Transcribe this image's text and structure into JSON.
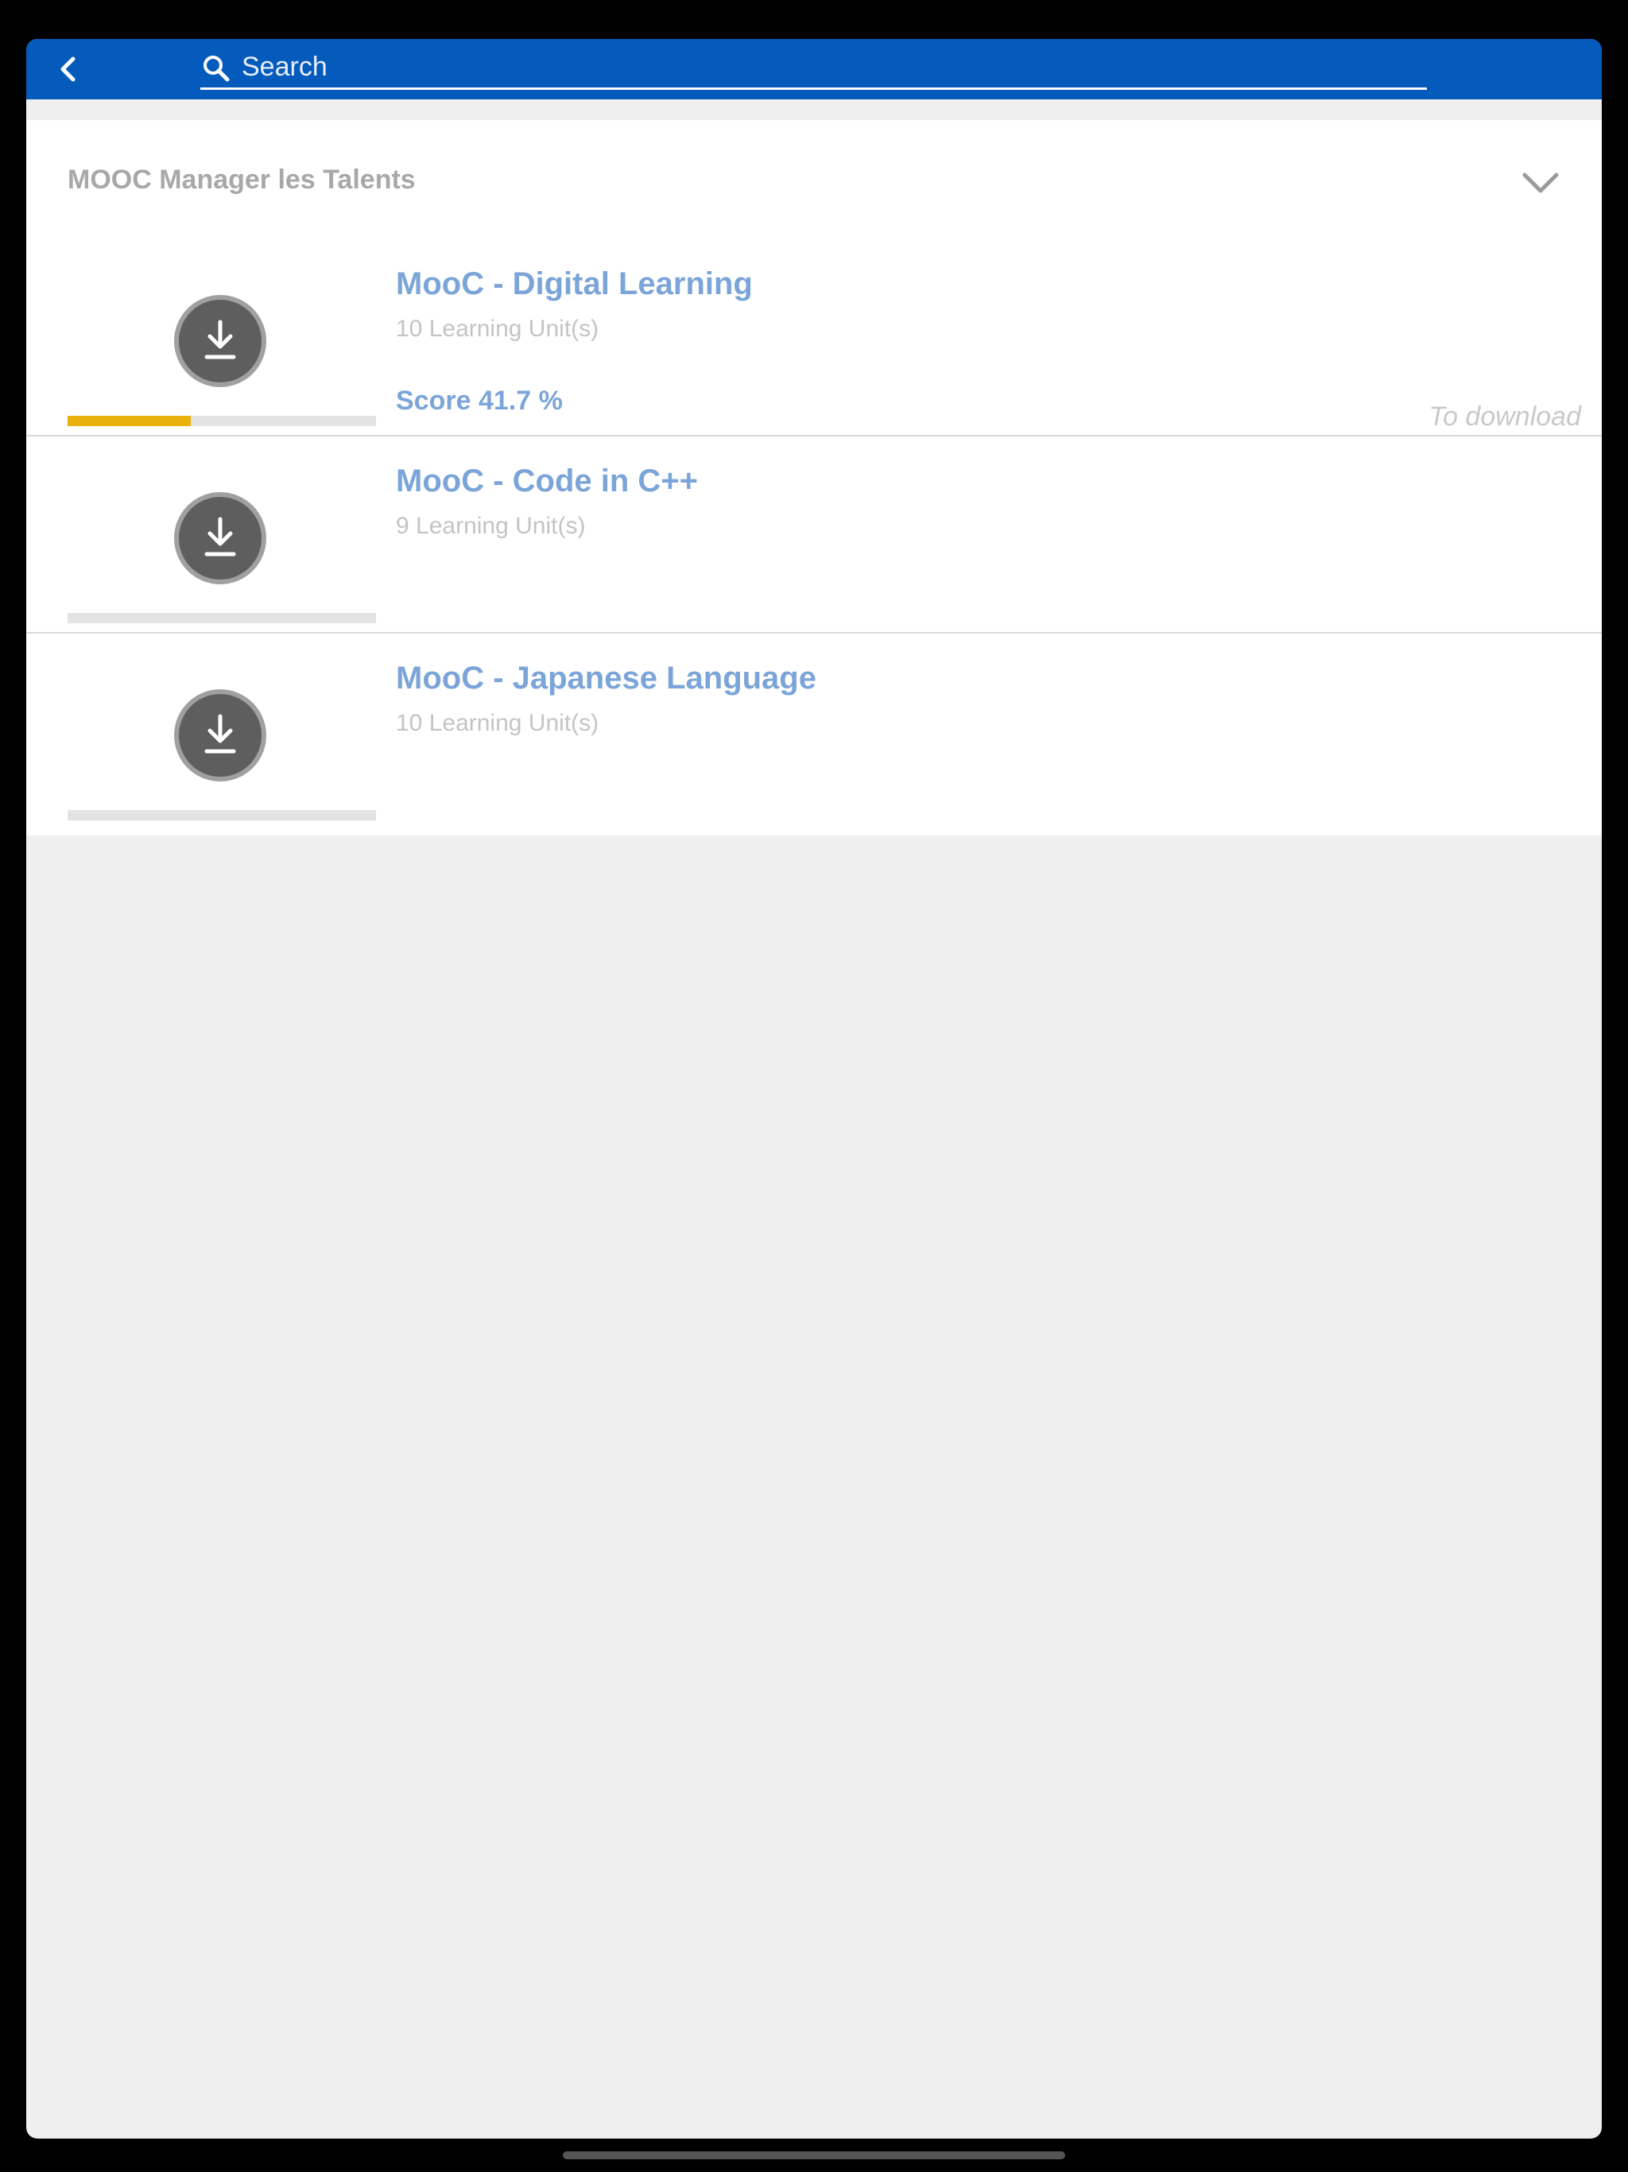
{
  "header": {
    "back_icon": "chevron-left-icon",
    "search": {
      "placeholder": "Search",
      "value": "",
      "icon": "search-icon"
    },
    "background_color": "#055bbb"
  },
  "section": {
    "title": "MOOC Manager les Talents",
    "toggle_icon": "chevron-down-icon",
    "expanded": true
  },
  "courses": [
    {
      "title": "MooC - Digital Learning",
      "units": "10 Learning Unit(s)",
      "score": "Score 41.7 %",
      "status": "To download",
      "progress": 0.4,
      "icon": "download-icon"
    },
    {
      "title": "MooC - Code in C++",
      "units": "9 Learning Unit(s)",
      "score": "",
      "status": "",
      "progress": 0,
      "icon": "download-icon"
    },
    {
      "title": "MooC - Japanese Language",
      "units": "10 Learning Unit(s)",
      "score": "",
      "status": "",
      "progress": 0,
      "icon": "download-icon"
    }
  ],
  "colors": {
    "accent": "#055bbb",
    "course_title": "#7ba5d8",
    "progress": "#e9b10b"
  }
}
